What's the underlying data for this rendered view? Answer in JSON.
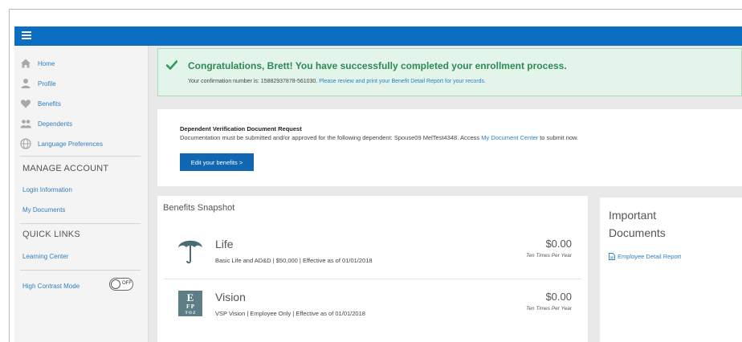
{
  "sidebar": {
    "items": [
      {
        "label": "Home",
        "icon": "home-icon"
      },
      {
        "label": "Profile",
        "icon": "person-icon"
      },
      {
        "label": "Benefits",
        "icon": "heart-icon"
      },
      {
        "label": "Dependents",
        "icon": "people-icon"
      },
      {
        "label": "Language Preferences",
        "icon": "globe-icon"
      }
    ],
    "manage_account": {
      "title": "MANAGE ACCOUNT",
      "links": [
        "Login Information",
        "My Documents"
      ]
    },
    "quick_links": {
      "title": "QUICK LINKS",
      "links": [
        "Learning Center"
      ]
    },
    "high_contrast": {
      "label": "High Contrast Mode",
      "state": "OFF"
    }
  },
  "success": {
    "title": "Congratulations, Brett! You have successfully completed your enrollment process.",
    "confirmation_text": "Your confirmation number is: 15882937878-561030.",
    "link_text": "Please review and print your Benefit Detail Report for your records."
  },
  "verification": {
    "title": "Dependent Verification Document Request",
    "body": "Documentation must be submitted and/or approved for the following dependent: Spouse09 MelTest4348. Access",
    "link_text": "My Document Center",
    "body_end": "to submit now.",
    "button": "Edit your benefits >"
  },
  "snapshot": {
    "title": "Benefits Snapshot",
    "benefits": [
      {
        "name": "Life",
        "desc": "Basic Life and AD&D | $50,000 | Effective as of 01/01/2018",
        "amount": "$0.00",
        "frequency": "Ten Times Per Year",
        "icon": "umbrella-icon"
      },
      {
        "name": "Vision",
        "desc": "VSP Vision | Employee Only | Effective as of 01/01/2018",
        "amount": "$0.00",
        "frequency": "Ten Times Per Year",
        "icon": "eye-chart-icon"
      }
    ]
  },
  "documents": {
    "title_line1": "Important",
    "title_line2": "Documents",
    "link": "Employee Detail Report"
  },
  "colors": {
    "topbar": "#0a6fc2",
    "link": "#2f7fc1",
    "success_text": "#2e8a55",
    "success_bg": "#e3f4ea",
    "button": "#1167b1"
  }
}
